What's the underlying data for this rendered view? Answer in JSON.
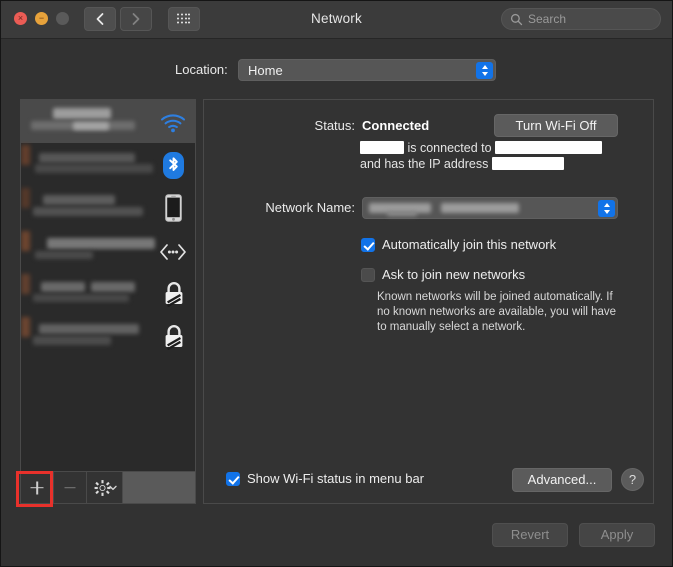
{
  "window": {
    "title": "Network",
    "traffic_lights": [
      {
        "name": "close",
        "glyph": "×",
        "color": "#eb5c55"
      },
      {
        "name": "minimize",
        "glyph": "−",
        "color": "#e7a23b"
      },
      {
        "name": "zoom",
        "glyph": "",
        "color": "#5a5a5a"
      }
    ],
    "toolbar": {
      "back_icon": "chevron-left-icon",
      "forward_icon": "chevron-right-icon",
      "grid_icon": "show-all-preferences-icon"
    },
    "search": {
      "placeholder": "Search",
      "icon": "search-icon",
      "value": ""
    }
  },
  "location": {
    "label": "Location:",
    "value": "Home"
  },
  "sidebar": {
    "services": [
      {
        "name": "service-wifi",
        "icon": "wifi-icon",
        "selected": true,
        "label_redacted": true
      },
      {
        "name": "service-bluetooth-pan",
        "icon": "bluetooth-icon",
        "selected": false,
        "label_redacted": true
      },
      {
        "name": "service-iphone-usb",
        "icon": "iphone-icon",
        "selected": false,
        "label_redacted": true
      },
      {
        "name": "service-thunderbolt-bridge",
        "icon": "ethernet-bridge-icon",
        "selected": false,
        "label_redacted": true
      },
      {
        "name": "service-vpn-1",
        "icon": "vpn-lock-icon",
        "selected": false,
        "label_redacted": true
      },
      {
        "name": "service-vpn-2",
        "icon": "vpn-lock-icon",
        "selected": false,
        "label_redacted": true
      }
    ],
    "toolbar": {
      "add_label": "+",
      "remove_label": "−",
      "action_icon": "gear-icon",
      "add_highlighted": true,
      "highlight_color": "#e8312b"
    }
  },
  "panel": {
    "status": {
      "label": "Status:",
      "value": "Connected",
      "button_label": "Turn Wi-Fi Off",
      "description_part1": "is connected to",
      "description_part2": "and",
      "description_part3": "has the IP address",
      "redacted_network_device": true,
      "redacted_ssid": true,
      "redacted_ip": true
    },
    "network_name": {
      "label": "Network Name:",
      "value_redacted": true,
      "value": ""
    },
    "checkboxes": [
      {
        "id": "auto-join",
        "label": "Automatically join this network",
        "checked": true
      },
      {
        "id": "ask-join",
        "label": "Ask to join new networks",
        "checked": false
      }
    ],
    "hint": "Known networks will be joined automatically. If no known networks are available, you will have to manually select a network.",
    "show_status": {
      "label": "Show Wi-Fi status in menu bar",
      "checked": true
    },
    "advanced_label": "Advanced...",
    "help_label": "?"
  },
  "footer": {
    "revert_label": "Revert",
    "apply_label": "Apply",
    "revert_enabled": false,
    "apply_enabled": false
  },
  "colors": {
    "accent": "#1273e8",
    "window_bg": "#323232",
    "titlebar_bg": "#3b3b3b",
    "panel_bg": "#333333",
    "highlight": "#e8312b"
  }
}
